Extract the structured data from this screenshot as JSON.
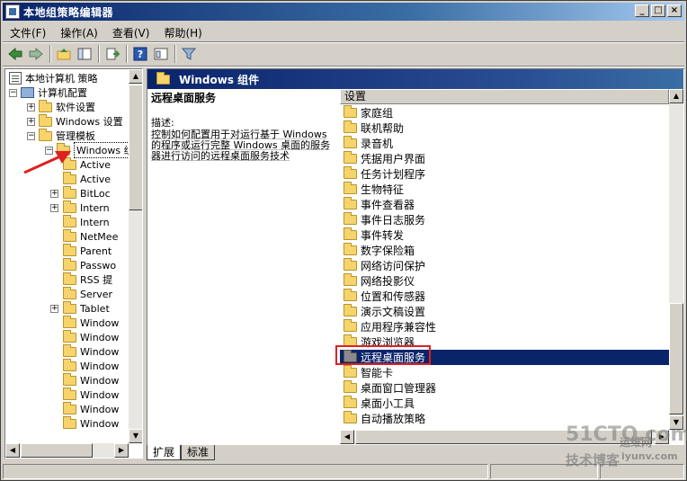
{
  "window": {
    "title": "本地组策略编辑器",
    "buttons": {
      "minimize": "_",
      "maximize": "□",
      "close": "×"
    }
  },
  "menu": [
    "文件(F)",
    "操作(A)",
    "查看(V)",
    "帮助(H)"
  ],
  "toolbar": {
    "icons": [
      "back-arrow-icon",
      "forward-arrow-icon",
      "up-folder-icon",
      "show-hide-tree-icon",
      "export-list-icon",
      "help-icon",
      "properties-icon",
      "filter-icon"
    ]
  },
  "tree": {
    "root": "本地计算机 策略",
    "computer_config": "计算机配置",
    "software_settings": "软件设置",
    "windows_settings": "Windows 设置",
    "admin_templates": "管理模板",
    "windows_components": "Windows 组",
    "children": [
      "Active",
      "Active",
      "BitLoc",
      "Intern",
      "Intern",
      "NetMee",
      "Parent",
      "Passwo",
      "RSS 提",
      "Server",
      "Tablet",
      "Window",
      "Window",
      "Window",
      "Window",
      "Window",
      "Window",
      "Window",
      "Window"
    ],
    "children_expandable": [
      false,
      false,
      true,
      true,
      false,
      false,
      false,
      false,
      false,
      false,
      true,
      false,
      false,
      false,
      false,
      false,
      false,
      false,
      false
    ]
  },
  "right_pane": {
    "header": "Windows 组件",
    "desc_title": "远程桌面服务",
    "desc_label": "描述:",
    "desc_text": "控制如何配置用于对运行基于 Windows 的程序或运行完整 Windows 桌面的服务器进行访问的远程桌面服务技术",
    "column_header": "设置",
    "items": [
      "家庭组",
      "联机帮助",
      "录音机",
      "凭据用户界面",
      "任务计划程序",
      "生物特征",
      "事件查看器",
      "事件日志服务",
      "事件转发",
      "数字保险箱",
      "网络访问保护",
      "网络投影仪",
      "位置和传感器",
      "演示文稿设置",
      "应用程序兼容性",
      "游戏浏览器",
      "远程桌面服务",
      "智能卡",
      "桌面窗口管理器",
      "桌面小工具",
      "自动播放策略"
    ],
    "selected_index": 16
  },
  "tabs": [
    "扩展",
    "标准"
  ],
  "active_tab": 0,
  "watermark": {
    "brand": "51CTO.com",
    "line2": "技术博客",
    "ext": "运维网",
    "site": "iyunv.com"
  },
  "colors": {
    "title_bar": "#0a246a",
    "selection": "#0a246a",
    "annotation": "#e02020",
    "folder": "#f7d36b"
  }
}
